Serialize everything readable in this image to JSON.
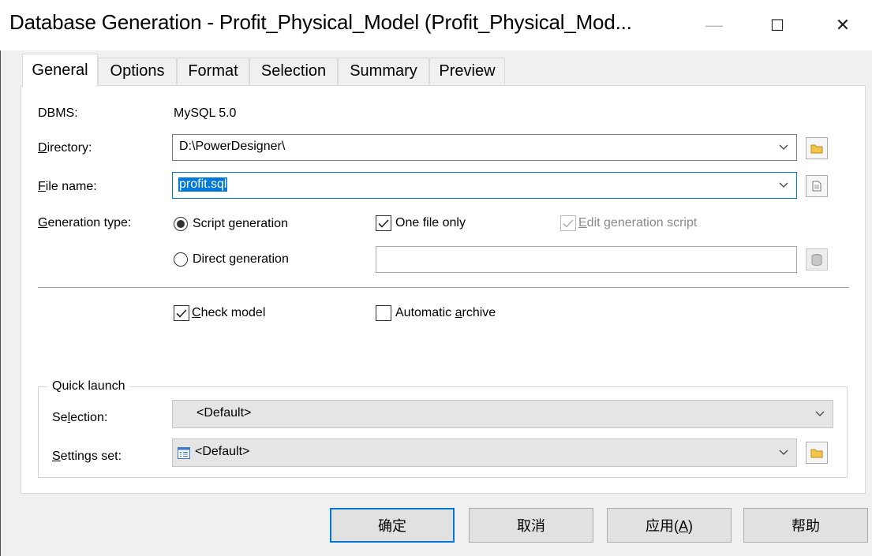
{
  "window": {
    "title": "Database Generation - Profit_Physical_Model (Profit_Physical_Mod...",
    "minimize_glyph": "—",
    "maximize_glyph": "☐",
    "close_glyph": "✕"
  },
  "tabs": [
    {
      "label": "General",
      "active": true
    },
    {
      "label": "Options"
    },
    {
      "label": "Format"
    },
    {
      "label": "Selection"
    },
    {
      "label": "Summary"
    },
    {
      "label": "Preview"
    }
  ],
  "general": {
    "dbms_label": "DBMS:",
    "dbms_value": "MySQL 5.0",
    "directory": {
      "label_first": "D",
      "label_rest": "irectory:",
      "value": "D:\\PowerDesigner\\"
    },
    "file_name": {
      "label_first": "F",
      "label_rest": "ile name:",
      "value": "profit.sql"
    },
    "generation_type": {
      "label_first": "G",
      "label_rest": "eneration type:"
    },
    "script_generation": {
      "label": "Script generation",
      "selected": true
    },
    "direct_generation": {
      "label": "Direct generation",
      "selected": false
    },
    "one_file_only": {
      "label": "One file only",
      "checked": true
    },
    "edit_generation_script": {
      "label_first": "E",
      "label_rest": "dit generation script",
      "checked": true,
      "disabled": true
    },
    "direct_field_value": "",
    "check_model": {
      "label_first": "C",
      "label_rest": "heck model",
      "checked": true
    },
    "automatic_archive": {
      "label_pre": "Automatic ",
      "label_u": "a",
      "label_rest": "rchive",
      "checked": false
    }
  },
  "quick_launch": {
    "title": "Quick launch",
    "selection": {
      "label_pre": "Se",
      "label_u": "l",
      "label_rest": "ection:",
      "value": "<Default>"
    },
    "settings_set": {
      "label_first": "S",
      "label_rest": "ettings set:",
      "value": "<Default>"
    }
  },
  "buttons": {
    "ok": "确定",
    "cancel": "取消",
    "apply_pre": "应用(",
    "apply_u": "A",
    "apply_post": ")",
    "help": "帮助"
  },
  "colors": {
    "accent": "#0078d7",
    "selection_bg": "#0078d7",
    "window_bg": "#f0f0f0"
  },
  "icons": {
    "dropdown": "chevron-down-icon",
    "browse": "folder-icon",
    "file": "document-icon",
    "direct": "database-icon",
    "settings": "settings-list-icon"
  }
}
